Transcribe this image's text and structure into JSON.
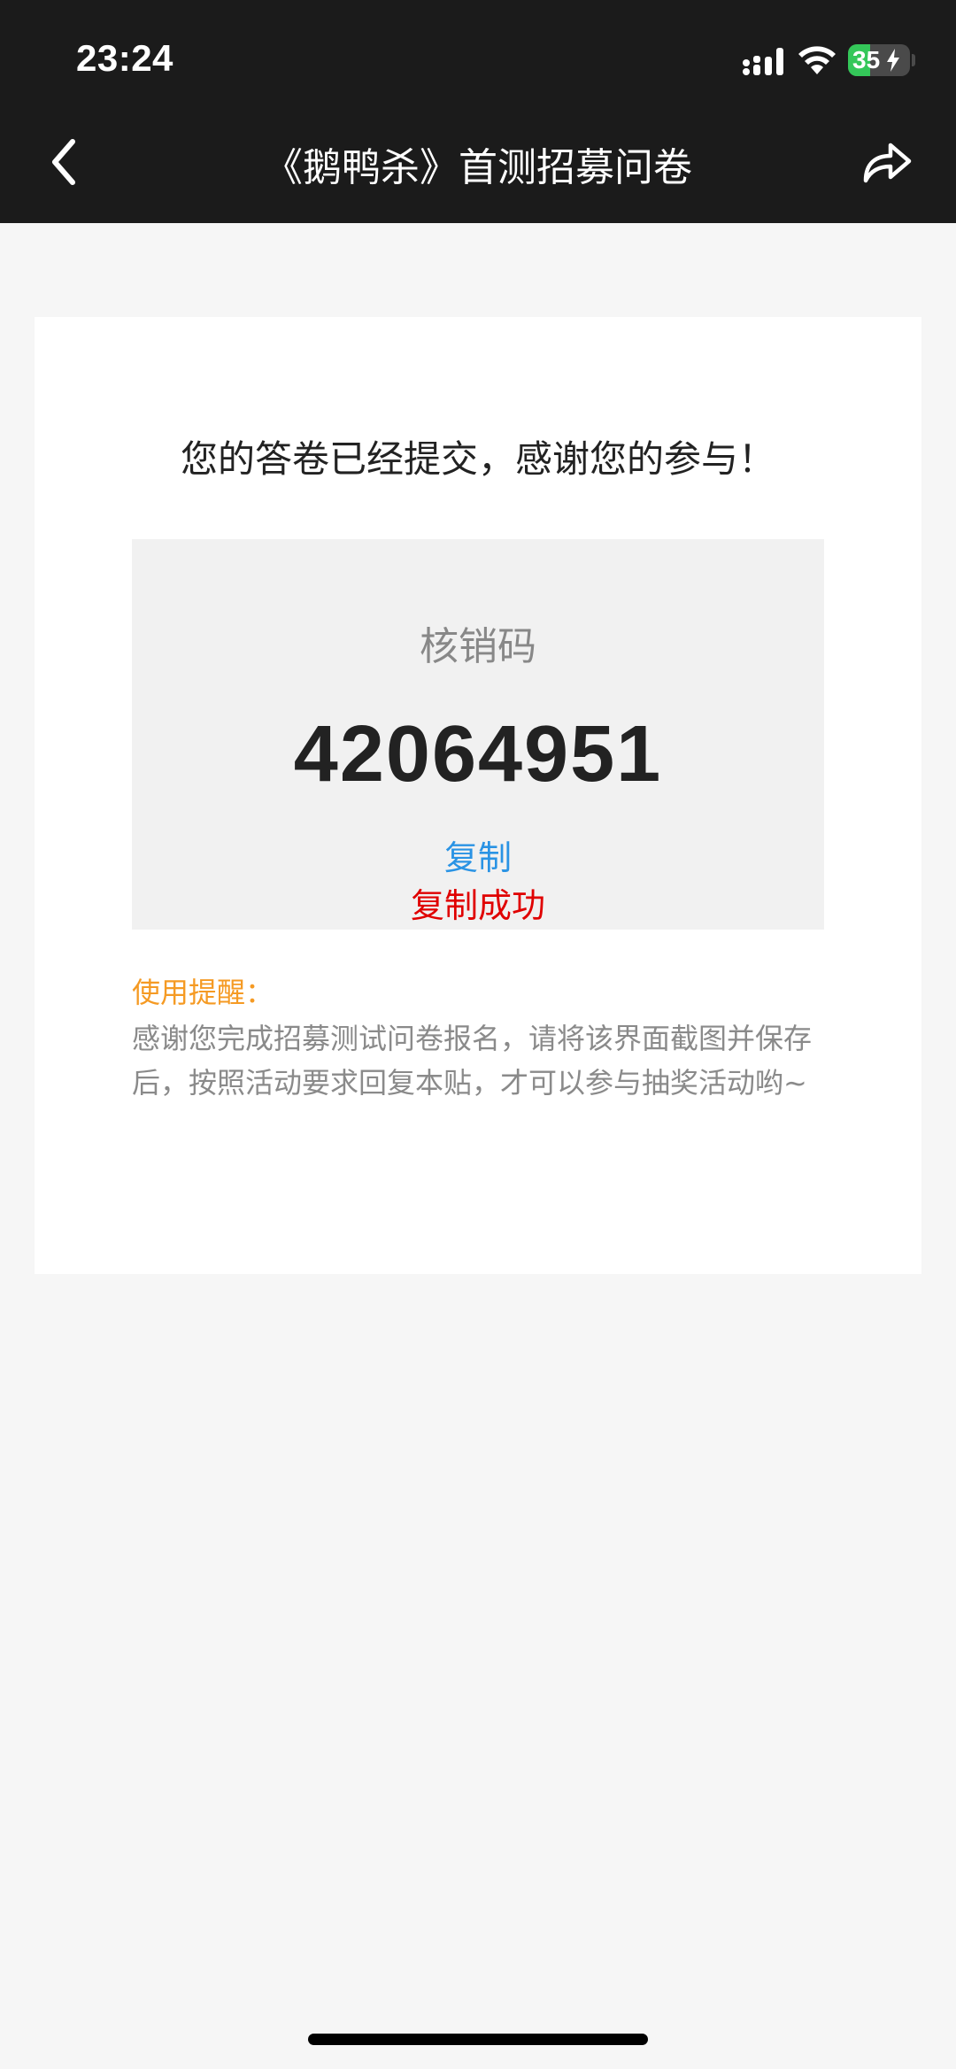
{
  "status_bar": {
    "time": "23:24",
    "battery_level": "35",
    "battery_color": "#34c759"
  },
  "nav": {
    "title": "《鹅鸭杀》首测招募问卷",
    "back_icon": "chevron-left-icon",
    "share_icon": "share-arrow-icon",
    "bg_color": "#1b1b1b"
  },
  "content": {
    "thanks_text": "您的答卷已经提交，感谢您的参与！",
    "code_label": "核销码",
    "code_value": "42064951",
    "copy_label": "复制",
    "copy_success": "复制成功",
    "tip_title": "使用提醒：",
    "tip_text": "感谢您完成招募测试问卷报名，请将该界面截图并保存后，按照活动要求回复本贴，才可以参与抽奖活动哟~"
  },
  "colors": {
    "link": "#2a93e4",
    "success": "#e00000",
    "tip_title": "#f59a23",
    "page_bg": "#f6f6f6"
  }
}
